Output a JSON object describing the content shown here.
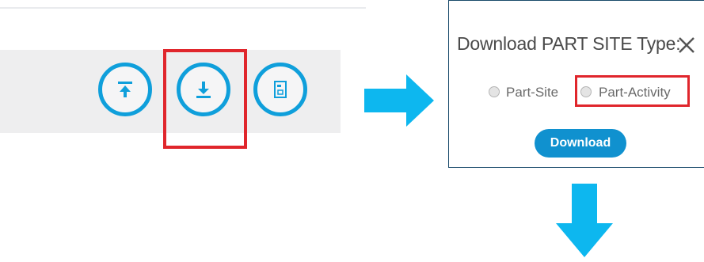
{
  "toolbar": {
    "buttons": [
      {
        "icon": "upload-icon"
      },
      {
        "icon": "download-icon"
      },
      {
        "icon": "report-icon"
      }
    ]
  },
  "dialog": {
    "title": "Download PART SITE Type:",
    "close_icon": "close-icon",
    "options": [
      {
        "label": "Part-Site",
        "selected": false
      },
      {
        "label": "Part-Activity",
        "selected": false
      }
    ],
    "download_label": "Download"
  },
  "colors": {
    "accent": "#0f9fdb",
    "highlight": "#e0262c",
    "arrow": "#0db7ef",
    "button": "#1091cf"
  }
}
